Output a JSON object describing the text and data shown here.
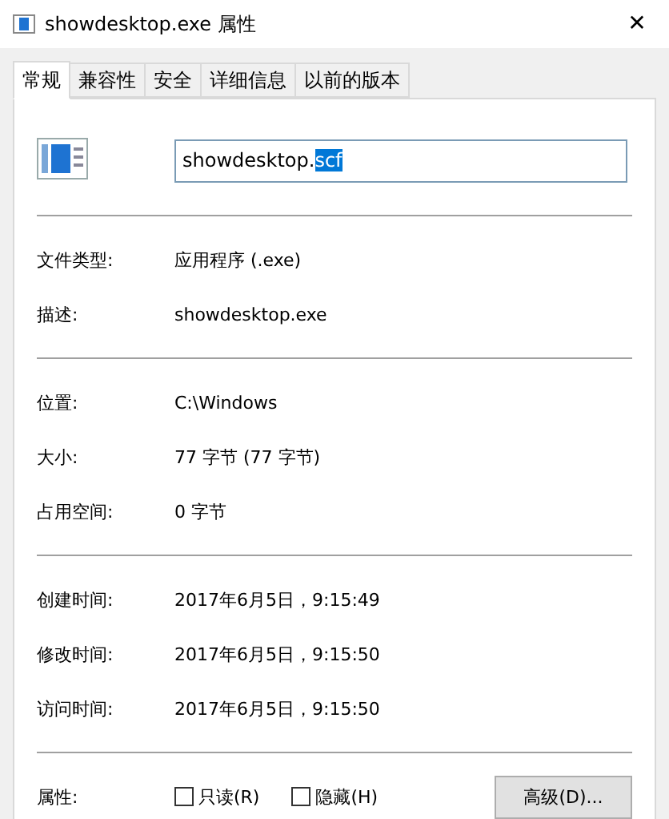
{
  "window": {
    "title": "showdesktop.exe 属性",
    "close": "✕"
  },
  "tabs": [
    {
      "label": "常规",
      "selected": true
    },
    {
      "label": "兼容性",
      "selected": false
    },
    {
      "label": "安全",
      "selected": false
    },
    {
      "label": "详细信息",
      "selected": false
    },
    {
      "label": "以前的版本",
      "selected": false
    }
  ],
  "name_field": {
    "value_before_selection": "showdesktop.",
    "selected_text": "scf"
  },
  "groups": [
    [
      {
        "label": "文件类型:",
        "value": "应用程序 (.exe)"
      },
      {
        "label": "描述:",
        "value": "showdesktop.exe"
      }
    ],
    [
      {
        "label": "位置:",
        "value": "C:\\Windows"
      },
      {
        "label": "大小:",
        "value": "77 字节 (77 字节)"
      },
      {
        "label": "占用空间:",
        "value": "0 字节"
      }
    ],
    [
      {
        "label": "创建时间:",
        "value": "2017年6月5日，9:15:49"
      },
      {
        "label": "修改时间:",
        "value": "2017年6月5日，9:15:50"
      },
      {
        "label": "访问时间:",
        "value": "2017年6月5日，9:15:50"
      }
    ]
  ],
  "attributes": {
    "label": "属性:",
    "checkboxes": [
      {
        "label": "只读(R)",
        "checked": false
      },
      {
        "label": "隐藏(H)",
        "checked": false
      }
    ],
    "button": "高级(D)..."
  }
}
